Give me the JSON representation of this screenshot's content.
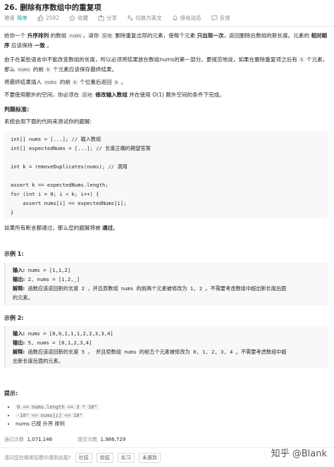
{
  "title": "26. 删除有序数组中的重复项",
  "meta": {
    "difficulty_label": "难度",
    "difficulty": "简单",
    "likes": "2592",
    "favorite": "收藏",
    "share": "分享",
    "switch_lang": "切换为英文",
    "notify": "接收动态",
    "feedback": "反馈"
  },
  "desc": {
    "p1_a": "给你一个 ",
    "p1_b": "升序排列",
    "p1_c": " 的数组 ",
    "p1_code": "nums",
    "p1_d": "，请你 ",
    "p1_link": "原地",
    "p1_e": " 删除重复出现的元素，使每个元素 ",
    "p1_f": "只出现一次",
    "p1_g": "，返回删除后数组的新长度。元素的 ",
    "p1_h": "相对顺序",
    "p1_i": " 应该保持 ",
    "p1_j": "一致",
    "p1_k": " 。",
    "p2_a": "由于在某些语言中不能改变数组的长度，所以必须将结果放在数组nums的第一部分。更规范地说，如果在删除重复项之后有 ",
    "p2_k": "k",
    "p2_b": " 个元素，那么 ",
    "p2_nums": "nums",
    "p2_c": " 的前 ",
    "p2_k2": "k",
    "p2_d": " 个元素应该保存最终结果。",
    "p3_a": "将最终结果插入 ",
    "p3_nums": "nums",
    "p3_b": " 的前 ",
    "p3_k": "k",
    "p3_c": " 个位置后返回 ",
    "p3_k2": "k",
    "p3_d": " 。",
    "p4_a": "不要使用额外的空间，你必须在 ",
    "p4_link": "原地",
    "p4_b": " 修改输入数组",
    "p4_c": " 并在使用 O(1) 额外空间的条件下完成。"
  },
  "judge_heading": "判题标准:",
  "judge_intro": "系统会用下面的代码来测试你的题解:",
  "judge_code": [
    "int[] nums = [...]; // 输入数组",
    "int[] expectedNums = [...]; // 长度正确的期望答案",
    "",
    "int k = removeDuplicates(nums); // 调用",
    "",
    "assert k == expectedNums.length;",
    "for (int i = 0; i < k; i++) {",
    "    assert nums[i] == expectedNums[i];",
    "}"
  ],
  "judge_after_a": "如果所有断言都通过，那么您的题解将被 ",
  "judge_after_b": "通过",
  "judge_after_c": "。",
  "example1": {
    "heading": "示例 1:",
    "input_label": "输入:",
    "input": " nums = [1,1,2]",
    "output_label": "输出:",
    "output": " 2, nums = [1,2,_]",
    "explain_label": "解释:",
    "explain_1": " 函数应该返回新的长度 2 ，并且原数组 nums 的前两个元素被修改为 1, 2 。不需要考虑数组中超出新长度后面",
    "explain_2": "的元素。"
  },
  "example2": {
    "heading": "示例 2:",
    "input_label": "输入:",
    "input": " nums = [0,0,1,1,1,2,2,3,3,4]",
    "output_label": "输出:",
    "output": " 5, nums = [0,1,2,3,4]",
    "explain_label": "解释:",
    "explain_1": " 函数应该返回新的长度 5 ， 并且原数组 nums 的前五个元素被修改为 0, 1, 2, 3, 4 。不需要考虑数组中超",
    "explain_2": "出新长度后面的元素。"
  },
  "hints_heading": "提示:",
  "hints": [
    "0 <= nums.length <= 3 * 10⁴",
    "-10⁴ <= nums[i] <= 10⁴",
    "nums 已按 升序 排列"
  ],
  "stats": {
    "pass_label": "通过次数",
    "pass_value": "1,071,146",
    "submit_label": "提交次数",
    "submit_value": "1,986,729"
  },
  "footer": {
    "question": "请问您在哪类招聘中遇到此题?",
    "btn1": "社招",
    "btn2": "校招",
    "btn3": "实习",
    "btn4": "未遇到"
  },
  "watermark": "知乎 @Blank"
}
